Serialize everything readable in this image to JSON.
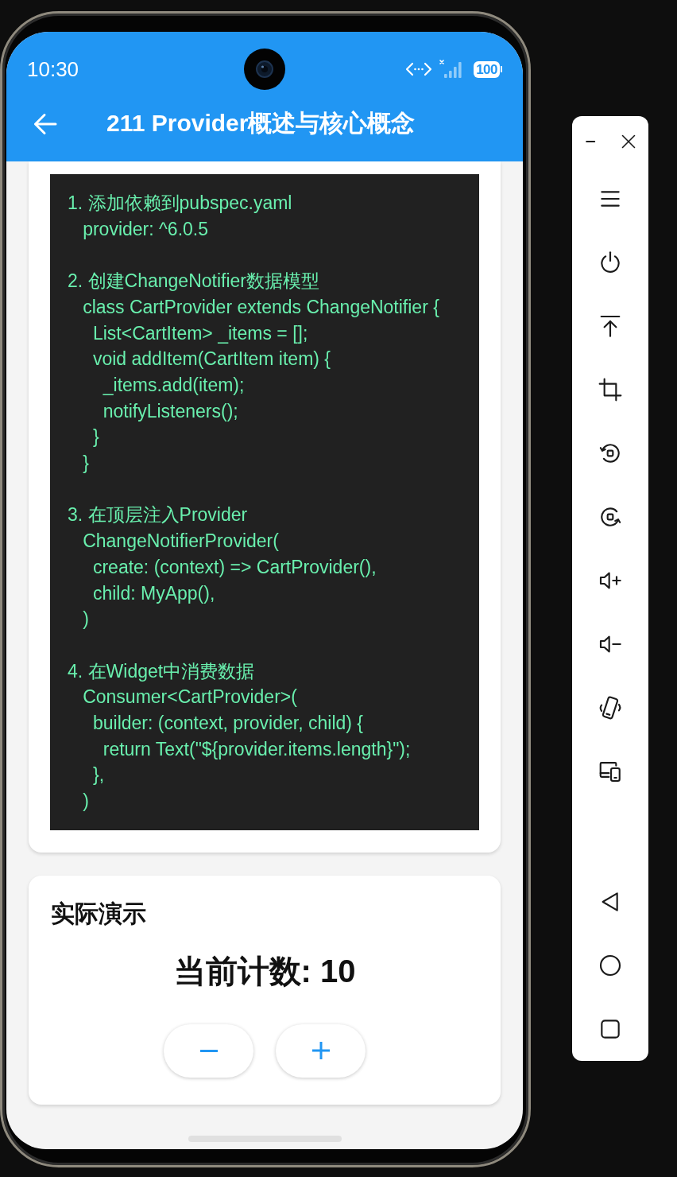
{
  "status_bar": {
    "time": "10:30",
    "battery": "100"
  },
  "app_bar": {
    "title": "211 Provider概述与核心概念"
  },
  "code_card": {
    "steps": [
      {
        "heading": "1. 添加依赖到pubspec.yaml",
        "code": "   provider: ^6.0.5"
      },
      {
        "heading": "2. 创建ChangeNotifier数据模型",
        "code": "   class CartProvider extends ChangeNotifier {\n     List<CartItem> _items = [];\n     void addItem(CartItem item) {\n       _items.add(item);\n       notifyListeners();\n     }\n   }"
      },
      {
        "heading": "3. 在顶层注入Provider",
        "code": "   ChangeNotifierProvider(\n     create: (context) => CartProvider(),\n     child: MyApp(),\n   )"
      },
      {
        "heading": "4. 在Widget中消费数据",
        "code": "   Consumer<CartProvider>(\n     builder: (context, provider, child) {\n       return Text(\"${provider.items.length}\");\n     },\n   )"
      }
    ]
  },
  "demo_card": {
    "title": "实际演示",
    "counter": "当前计数: 10",
    "buttons": [
      {
        "kind": "decrement"
      },
      {
        "kind": "increment"
      }
    ]
  }
}
